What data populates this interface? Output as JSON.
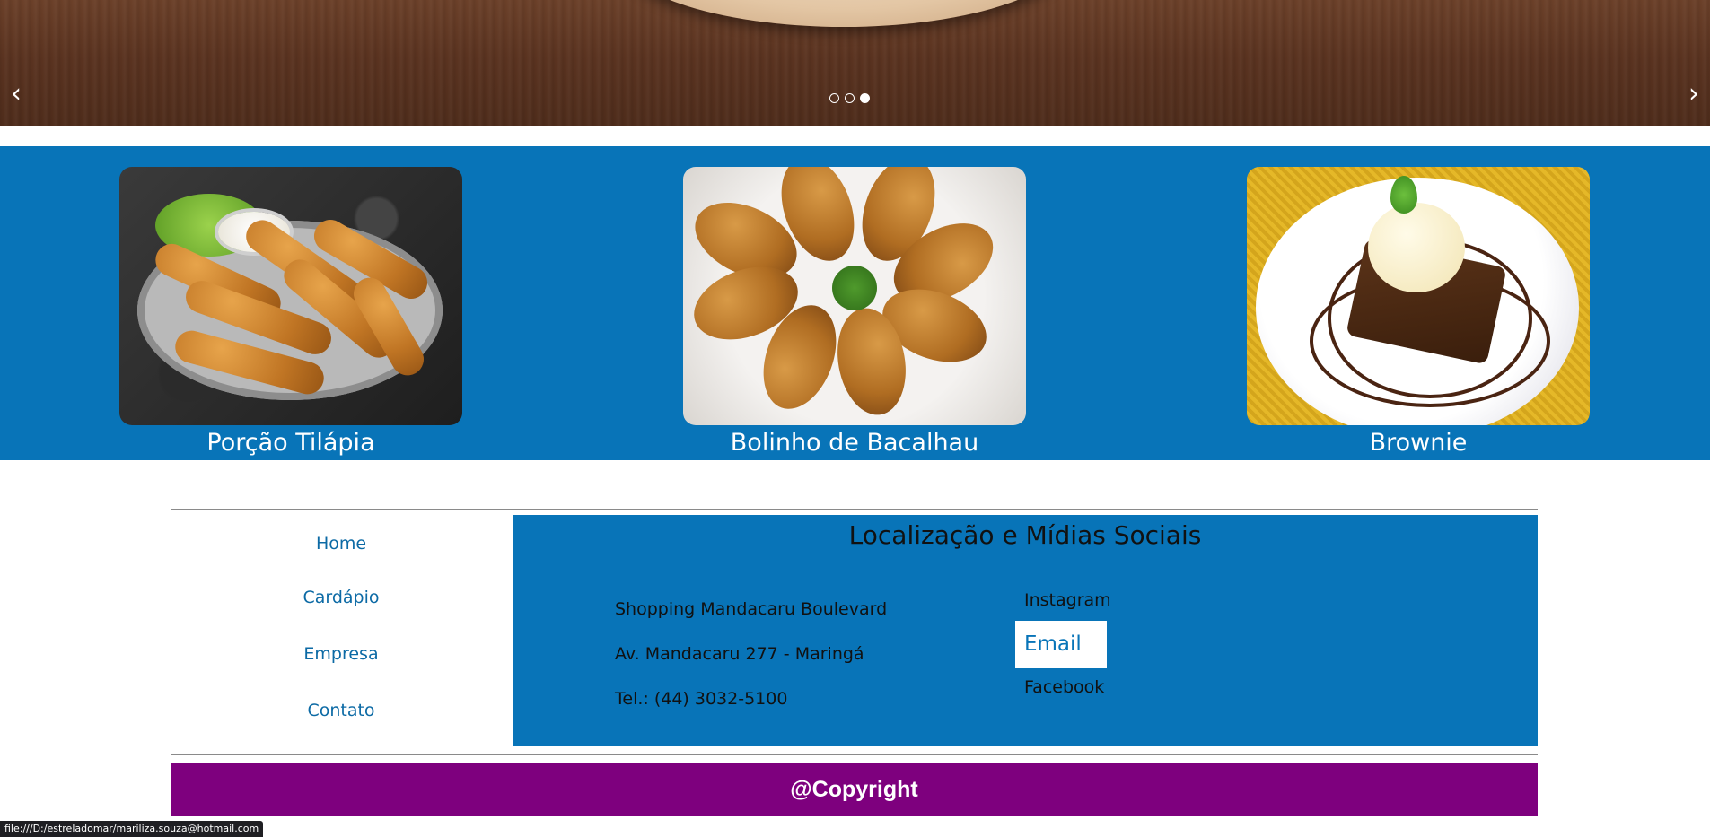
{
  "carousel": {
    "prev_icon": "chevron-left",
    "next_icon": "chevron-right",
    "prev_symbol": "‹",
    "next_symbol": "›",
    "slide_count": 3,
    "active_slide": 3
  },
  "featured": {
    "background_color": "#0874b8",
    "items": [
      {
        "caption": "Porção Tilápia"
      },
      {
        "caption": "Bolinho de Bacalhau"
      },
      {
        "caption": "Brownie"
      }
    ]
  },
  "nav": {
    "items": [
      {
        "label": "Home"
      },
      {
        "label": "Cardápio"
      },
      {
        "label": "Empresa"
      },
      {
        "label": "Contato"
      }
    ]
  },
  "social": {
    "heading": "Localização e Mídias Sociais",
    "address": [
      "Shopping Mandacaru Boulevard",
      "Av. Mandacaru 277 - Maringá",
      "Tel.: (44) 3032-5100"
    ],
    "links": [
      {
        "label": "Instagram"
      },
      {
        "label": "Email"
      },
      {
        "label": "Facebook"
      }
    ]
  },
  "footer": {
    "copyright": "@Copyright",
    "color": "#7e007e"
  },
  "status_bar": {
    "url": "file:///D:/estreladomar/mariliza.souza@hotmail.com"
  }
}
